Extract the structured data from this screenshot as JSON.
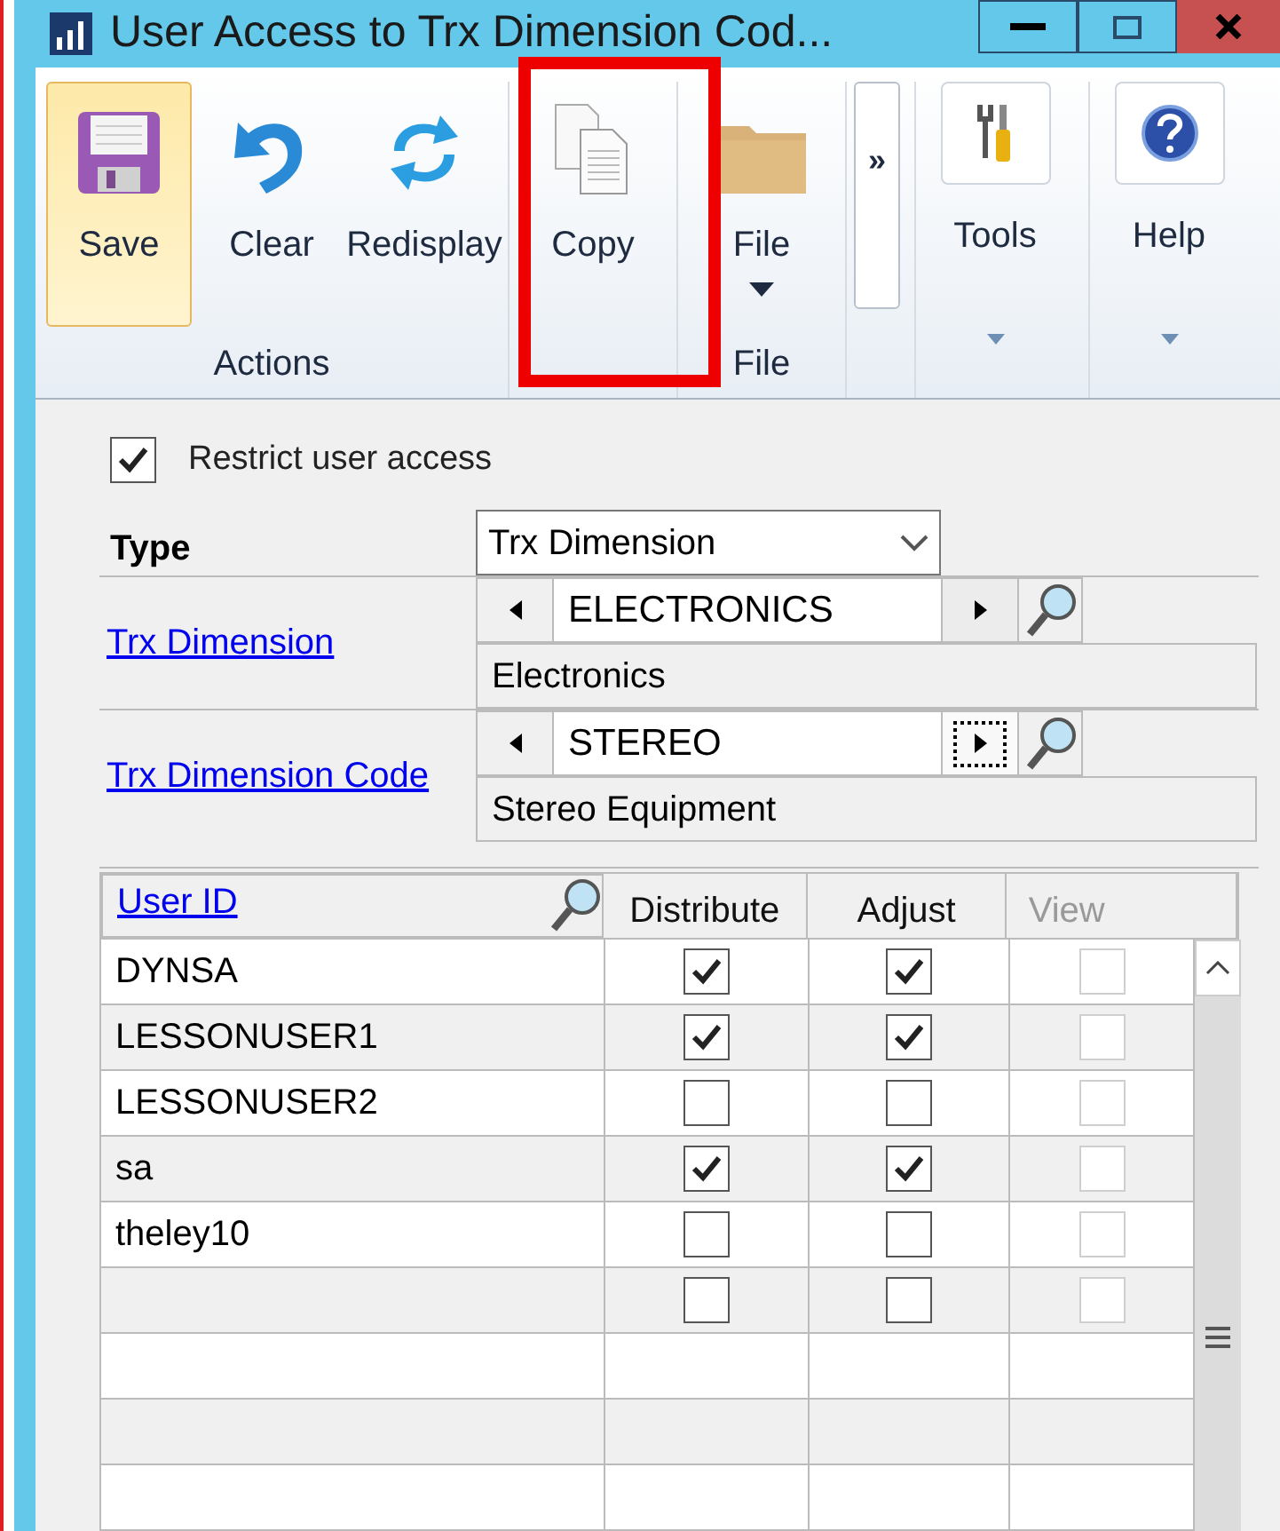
{
  "window": {
    "title": "User Access to Trx Dimension Cod..."
  },
  "ribbon": {
    "groups": [
      {
        "label": "Actions",
        "buttons": [
          {
            "kind": "save",
            "label": "Save",
            "highlighted": true
          },
          {
            "kind": "clear",
            "label": "Clear",
            "highlighted": false
          },
          {
            "kind": "redisplay",
            "label": "Redisplay",
            "highlighted": false
          }
        ]
      },
      {
        "buttons": [
          {
            "kind": "copy",
            "label": "Copy",
            "highlighted": false
          }
        ]
      },
      {
        "label": "File",
        "buttons": [
          {
            "kind": "file",
            "label": "File",
            "highlighted": false
          }
        ]
      }
    ],
    "overflow": "»",
    "menus": [
      {
        "kind": "tools",
        "label": "Tools"
      },
      {
        "kind": "help",
        "label": "Help"
      }
    ]
  },
  "form": {
    "restrict": {
      "label": "Restrict user access",
      "checked": true
    },
    "type": {
      "label": "Type",
      "value": "Trx Dimension"
    },
    "fields": [
      {
        "label": "Trx Dimension",
        "value": "ELECTRONICS",
        "description": "Electronics",
        "focused": false
      },
      {
        "label": "Trx Dimension Code",
        "value": "STEREO",
        "description": "Stereo Equipment",
        "focused": true
      }
    ]
  },
  "grid": {
    "columns": [
      {
        "label": "User ID",
        "disabled": false
      },
      {
        "label": "Distribute",
        "disabled": false
      },
      {
        "label": "Adjust",
        "disabled": false
      },
      {
        "label": "View",
        "disabled": true
      }
    ],
    "rows": [
      {
        "kind": "entry",
        "user_id": "DYNSA",
        "distribute": true,
        "adjust": true,
        "view": false
      },
      {
        "kind": "entry",
        "user_id": "LESSONUSER1",
        "distribute": true,
        "adjust": true,
        "view": false
      },
      {
        "kind": "entry",
        "user_id": "LESSONUSER2",
        "distribute": false,
        "adjust": false,
        "view": false
      },
      {
        "kind": "entry",
        "user_id": "sa",
        "distribute": true,
        "adjust": true,
        "view": false
      },
      {
        "kind": "entry",
        "user_id": "theley10",
        "distribute": false,
        "adjust": false,
        "view": false
      },
      {
        "kind": "entry",
        "distribute": false,
        "adjust": false,
        "view": false
      },
      {
        "kind": "blank"
      },
      {
        "kind": "blank"
      },
      {
        "kind": "blank"
      }
    ]
  }
}
